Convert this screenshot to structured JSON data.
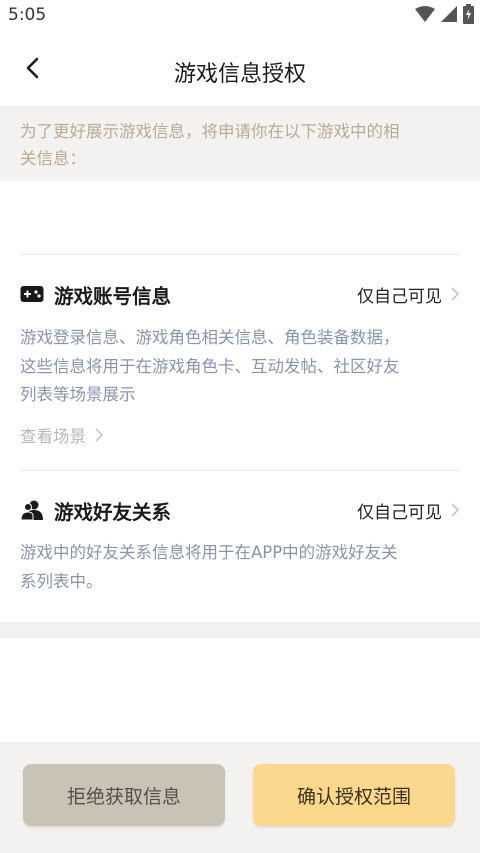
{
  "status_bar": {
    "time": "5:05"
  },
  "header": {
    "title": "游戏信息授权"
  },
  "notice": {
    "line1": "为了更好展示游戏信息，将申请你在以下游戏中的相",
    "line2": "关信息："
  },
  "sections": [
    {
      "title": "游戏账号信息",
      "visibility": "仅自己可见",
      "desc_lines": [
        "游戏登录信息、游戏角色相关信息、角色装备数据，",
        "这些信息将用于在游戏角色卡、互动发帖、社区好友",
        "列表等场景展示"
      ],
      "link": "查看场景"
    },
    {
      "title": "游戏好友关系",
      "visibility": "仅自己可见",
      "desc_lines": [
        "游戏中的好友关系信息将用于在APP中的游戏好友关",
        "系列表中。"
      ]
    }
  ],
  "footer": {
    "reject_label": "拒绝获取信息",
    "confirm_label": "确认授权范围"
  },
  "colors": {
    "accent": "#fbd88e",
    "reject": "#c9c3b6",
    "desc_text": "#8794ad",
    "notice_text": "#b9ab93"
  }
}
